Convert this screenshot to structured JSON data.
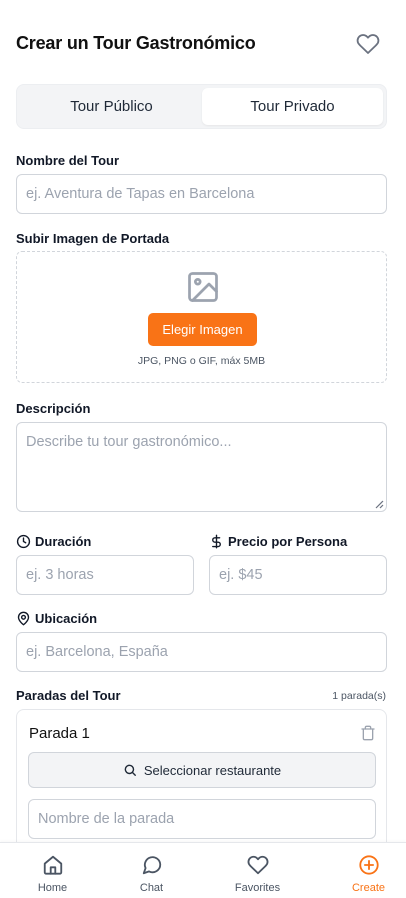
{
  "header": {
    "title": "Crear un Tour Gastronómico",
    "favorite_icon": "heart-icon"
  },
  "segment": {
    "options": [
      "Tour Público",
      "Tour Privado"
    ],
    "selected": "Tour Privado"
  },
  "form": {
    "name": {
      "label": "Nombre del Tour",
      "placeholder": "ej. Aventura de Tapas en Barcelona"
    },
    "cover": {
      "label": "Subir Imagen de Portada",
      "icon": "image-icon",
      "button": "Elegir Imagen",
      "hint": "JPG, PNG o GIF, máx 5MB"
    },
    "description": {
      "label": "Descripción",
      "placeholder": "Describe tu tour gastronómico..."
    },
    "duration": {
      "label": "Duración",
      "icon": "clock-icon",
      "placeholder": "ej. 3 horas"
    },
    "price": {
      "label": "Precio por Persona",
      "icon": "dollar-icon",
      "placeholder": "ej. $45"
    },
    "location": {
      "label": "Ubicación",
      "icon": "map-pin-icon",
      "placeholder": "ej. Barcelona, España"
    },
    "stops": {
      "label": "Paradas del Tour",
      "count": "1 parada(s)",
      "items": [
        {
          "title": "Parada 1",
          "select_label": "Seleccionar restaurante",
          "name_placeholder": "Nombre de la parada"
        }
      ]
    }
  },
  "nav": {
    "items": [
      {
        "label": "Home",
        "icon": "home-icon"
      },
      {
        "label": "Chat",
        "icon": "chat-icon"
      },
      {
        "label": "Favorites",
        "icon": "heart-icon"
      },
      {
        "label": "Create",
        "icon": "plus-circle-icon"
      }
    ],
    "active": "Create"
  },
  "colors": {
    "accent": "#f97316",
    "text": "#111827",
    "muted": "#9ca3af",
    "border": "#d1d5db"
  }
}
